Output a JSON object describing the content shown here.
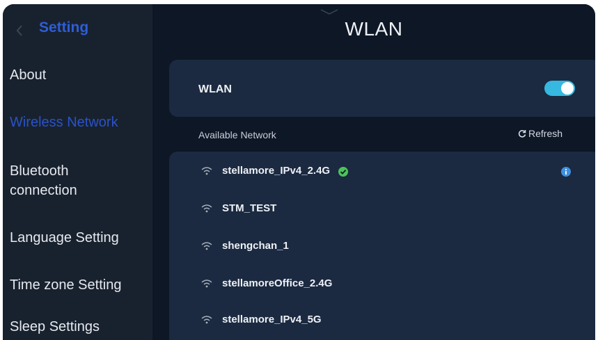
{
  "sidebar": {
    "title": "Setting",
    "items": [
      {
        "label": "About",
        "active": false
      },
      {
        "label": "Wireless Network",
        "active": true
      },
      {
        "label": "Bluetooth\nconnection",
        "active": false
      },
      {
        "label": "Language Setting",
        "active": false
      },
      {
        "label": "Time zone Setting",
        "active": false
      },
      {
        "label": "Sleep Settings",
        "active": false
      }
    ]
  },
  "main": {
    "title": "WLAN",
    "wlan_toggle": {
      "label": "WLAN",
      "enabled": true
    },
    "available_label": "Available Network",
    "refresh_label": "Refresh",
    "networks": [
      {
        "name": "stellamore_IPv4_2.4G",
        "connected": true,
        "info_icon": "info-icon"
      },
      {
        "name": "STM_TEST",
        "connected": false
      },
      {
        "name": "shengchan_1",
        "connected": false
      },
      {
        "name": "stellamoreOffice_2.4G",
        "connected": false
      },
      {
        "name": "stellamore_IPv4_5G",
        "connected": false
      }
    ]
  },
  "colors": {
    "background": "#0d1726",
    "sidebar": "#18222f",
    "card": "#1b2a40",
    "accent_blue": "#2a52c8",
    "toggle_on": "#36b8e0",
    "connected_green": "#4cc35a",
    "info_blue": "#3f8fe0"
  }
}
